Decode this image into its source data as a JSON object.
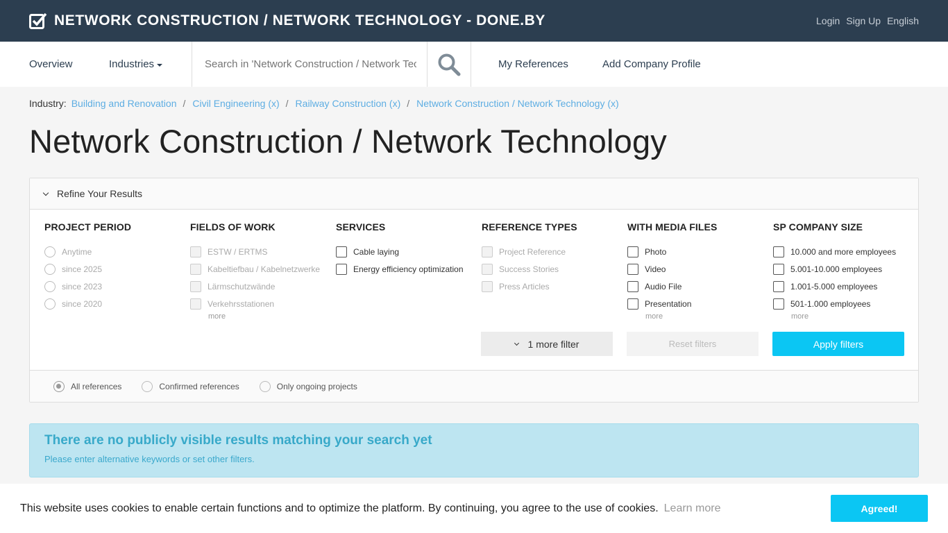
{
  "header": {
    "brand": "NETWORK CONSTRUCTION / NETWORK TECHNOLOGY - DONE.BY",
    "login": "Login",
    "signup": "Sign Up",
    "language": "English"
  },
  "nav": {
    "overview": "Overview",
    "industries": "Industries",
    "search_placeholder": "Search in 'Network Construction / Network Technology'",
    "my_references": "My References",
    "add_company": "Add Company Profile"
  },
  "breadcrumb": {
    "label": "Industry:",
    "items": [
      "Building and Renovation",
      "Civil Engineering (x)",
      "Railway Construction (x)",
      "Network Construction / Network Technology (x)"
    ]
  },
  "page_title": "Network Construction / Network Technology",
  "filters": {
    "heading": "Refine Your Results",
    "columns": [
      {
        "title": "PROJECT PERIOD",
        "options": [
          "Anytime",
          "since 2025",
          "since 2023",
          "since 2020"
        ]
      },
      {
        "title": "FIELDS OF WORK",
        "options": [
          "ESTW / ERTMS",
          "Kabeltiefbau / Kabelnetzwerke",
          "Lärmschutzwände",
          "Verkehrsstationen"
        ],
        "more": "more"
      },
      {
        "title": "SERVICES",
        "options": [
          "Cable laying",
          "Energy efficiency optimization"
        ]
      },
      {
        "title": "REFERENCE TYPES",
        "options": [
          "Project Reference",
          "Success Stories",
          "Press Articles"
        ]
      },
      {
        "title": "WITH MEDIA FILES",
        "options": [
          "Photo",
          "Video",
          "Audio File",
          "Presentation"
        ],
        "more": "more"
      },
      {
        "title": "SP COMPANY SIZE",
        "options": [
          "10.000 and more employees",
          "5.001-10.000 employees",
          "1.001-5.000 employees",
          "501-1.000 employees"
        ],
        "more": "more"
      }
    ],
    "more_filter": "1 more filter",
    "reset": "Reset filters",
    "apply": "Apply filters",
    "scope": [
      "All references",
      "Confirmed references",
      "Only ongoing projects"
    ]
  },
  "alert": {
    "title": "There are no publicly visible results matching your search yet",
    "text": "Please enter alternative keywords or set other filters."
  },
  "cookie": {
    "text": "This website uses cookies to enable certain functions and to optimize the platform. By continuing, you agree to the use of cookies.",
    "learn_more": "Learn more",
    "agree": "Agreed!"
  }
}
